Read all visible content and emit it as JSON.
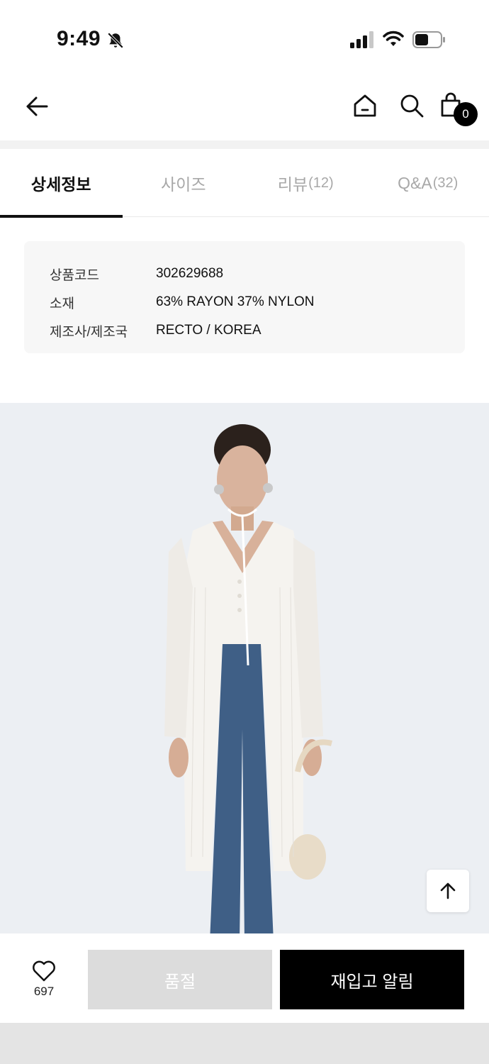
{
  "status_bar": {
    "time": "9:49"
  },
  "cart": {
    "count": "0"
  },
  "tabs": [
    {
      "label": "상세정보",
      "count": ""
    },
    {
      "label": "사이즈",
      "count": ""
    },
    {
      "label": "리뷰",
      "count": "(12)"
    },
    {
      "label": "Q&A",
      "count": "(32)"
    }
  ],
  "product_info": [
    {
      "label": "상품코드",
      "value": "302629688"
    },
    {
      "label": "소재",
      "value": "63% RAYON 37% NYLON"
    },
    {
      "label": "제조사/제조국",
      "value": "RECTO / KOREA"
    }
  ],
  "bottom_bar": {
    "like_count": "697",
    "soldout_label": "품절",
    "restock_label": "재입고 알림"
  },
  "icons": [
    "bell-off-icon",
    "signal-icon",
    "wifi-icon",
    "battery-icon",
    "back-arrow-icon",
    "home-icon",
    "search-icon",
    "shopping-bag-icon",
    "arrow-up-icon",
    "heart-icon"
  ]
}
